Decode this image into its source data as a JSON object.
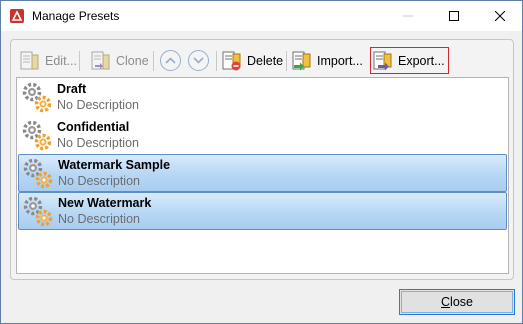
{
  "window": {
    "title": "Manage Presets"
  },
  "toolbar": {
    "edit_label": "Edit...",
    "clone_label": "Clone",
    "delete_label": "Delete",
    "import_label": "Import...",
    "export_label": "Export..."
  },
  "presets": [
    {
      "name": "Draft",
      "description": "No Description",
      "selected": false
    },
    {
      "name": "Confidential",
      "description": "No Description",
      "selected": false
    },
    {
      "name": "Watermark Sample",
      "description": "No Description",
      "selected": true
    },
    {
      "name": "New Watermark",
      "description": "No Description",
      "selected": true
    }
  ],
  "footer": {
    "close_underlined": "C",
    "close_rest": "lose"
  },
  "colors": {
    "selection": "#b7d7f4",
    "selection_border": "#5f8fc7",
    "export_highlight": "#d0282c",
    "gear_gray": "#8a8a8a",
    "gear_orange": "#f0a030"
  }
}
